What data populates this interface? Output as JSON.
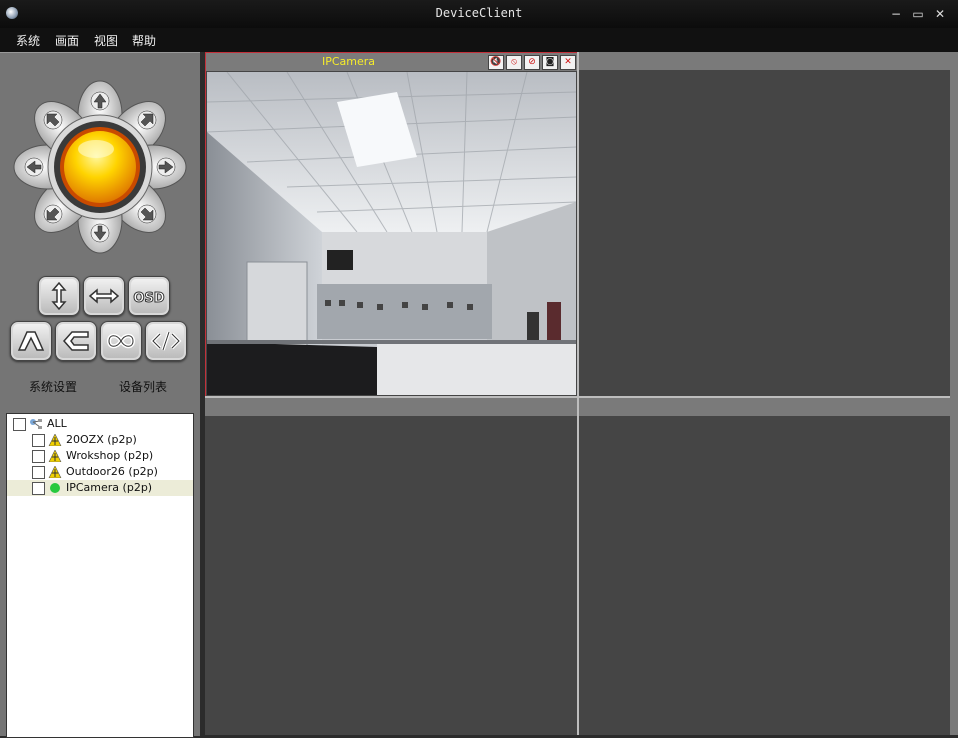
{
  "window": {
    "title": "DeviceClient",
    "min": "−",
    "max": "▭",
    "close": "✕"
  },
  "menu": {
    "items": [
      "系统",
      "画面",
      "视图",
      "帮助"
    ]
  },
  "left_panel": {
    "ptz_icons": [
      "arrow-up-icon",
      "arrow-down-icon",
      "arrow-left-icon",
      "arrow-right-icon",
      "arrow-up-left-icon",
      "arrow-up-right-icon",
      "arrow-down-left-icon",
      "arrow-down-right-icon"
    ],
    "buttons_row1": [
      "vertical-flip-icon",
      "horizontal-flip-icon",
      "osd-icon"
    ],
    "osd_label": "OSD",
    "buttons_row2": [
      "zoom-in-icon",
      "zoom-out-icon",
      "focus-icon",
      "iris-icon"
    ],
    "system_settings_label": "系统设置",
    "device_list_label": "设备列表"
  },
  "device_tree": {
    "root": {
      "label": "ALL",
      "checked": false
    },
    "devices": [
      {
        "label": "20OZX (p2p)",
        "status": "offline",
        "checked": false
      },
      {
        "label": "Wrokshop (p2p)",
        "status": "offline",
        "checked": false
      },
      {
        "label": "Outdoor26 (p2p)",
        "status": "offline",
        "checked": false
      },
      {
        "label": "IPCamera (p2p)",
        "status": "online",
        "checked": false,
        "selected": true
      }
    ]
  },
  "video_grid": {
    "active_channel": {
      "title": "IPCamera",
      "title_color": "#f6ec2a",
      "border_color": "#c3303a",
      "toolbar": [
        "mute-icon",
        "record-icon",
        "snapshot-record-icon",
        "camera-icon",
        "close-icon"
      ]
    }
  },
  "colors": {
    "accent_yellow": "#f6ec2a",
    "active_border": "#c3303a",
    "online": "#27c93f"
  }
}
